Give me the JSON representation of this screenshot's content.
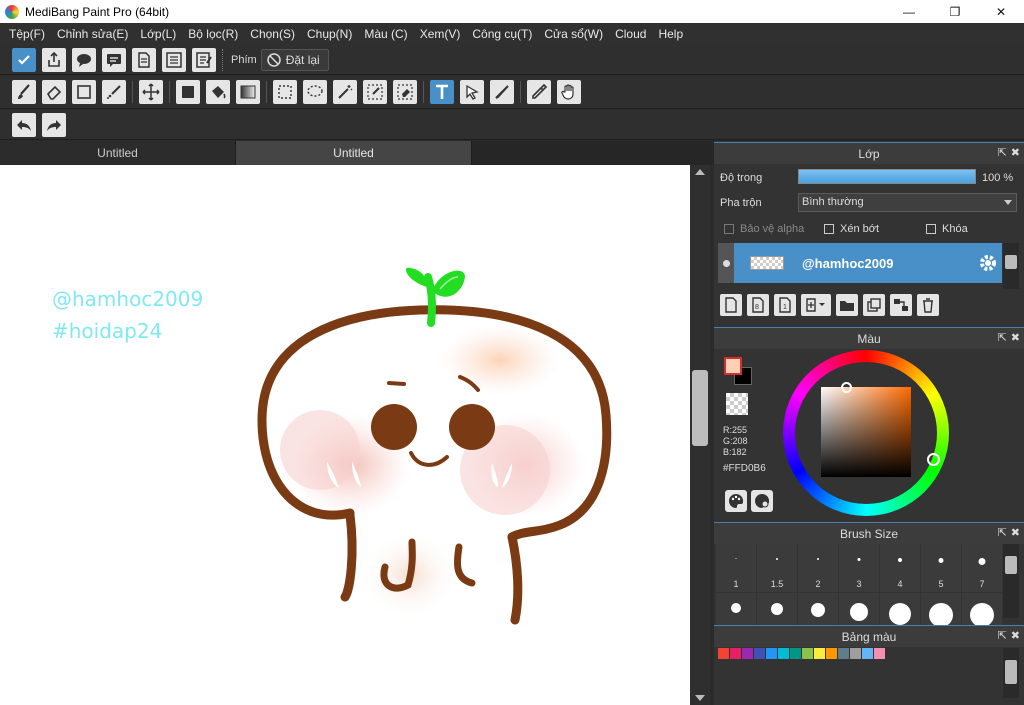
{
  "window": {
    "title": "MediBang Paint Pro (64bit)",
    "min_glyph": "—",
    "max_glyph": "❐",
    "close_glyph": "✕"
  },
  "menu": [
    "Tệp(F)",
    "Chỉnh sửa(E)",
    "Lớp(L)",
    "Bộ lọc(R)",
    "Chọn(S)",
    "Chụp(N)",
    "Màu (C)",
    "Xem(V)",
    "Công cụ(T)",
    "Cửa sổ(W)",
    "Cloud",
    "Help"
  ],
  "toolbar": {
    "phim_label": "Phím",
    "reset_label": "Đặt lại"
  },
  "tabs": [
    "Untitled",
    "Untitled"
  ],
  "canvas": {
    "line1": "@hamhoc2009",
    "line2": "#hoidap24"
  },
  "layer_panel": {
    "title": "Lớp",
    "opacity_label": "Độ trong",
    "opacity_value": "100 %",
    "opacity": 1.0,
    "blend_label": "Pha trộn",
    "blend_value": "Bình thường",
    "protect_alpha": "Bảo vệ alpha",
    "clip": "Xén bớt",
    "lock": "Khóa",
    "layer_name": "@hamhoc2009"
  },
  "color_panel": {
    "title": "Màu",
    "r": "R:255",
    "g": "G:208",
    "b": "B:182",
    "hex": "#FFD0B6",
    "fg_color": "#FFD0B6",
    "accent": "#4a90c8"
  },
  "brush_panel": {
    "title": "Brush Size",
    "sizes": [
      "1",
      "1.5",
      "2",
      "3",
      "4",
      "5",
      "7"
    ]
  },
  "palette_panel": {
    "title": "Bảng màu",
    "colors": [
      "#f44336",
      "#e91e63",
      "#9c27b0",
      "#3f51b5",
      "#2196f3",
      "#00bcd4",
      "#009688",
      "#8bc34a",
      "#ffeb3b",
      "#ff9800",
      "#607d8b",
      "#9e9e9e",
      "#64b5f6",
      "#f48fb1"
    ]
  }
}
